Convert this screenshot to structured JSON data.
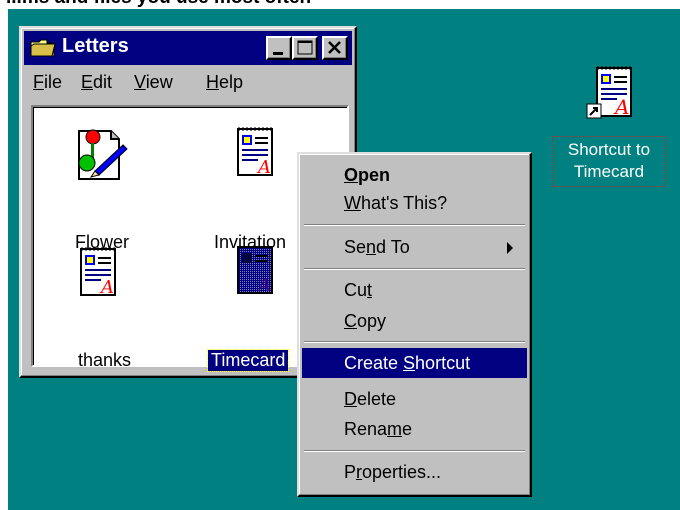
{
  "caption": "...ms and files you use most often",
  "window": {
    "title": "Letters",
    "menu": [
      "File",
      "Edit",
      "View",
      "Help"
    ],
    "files": [
      {
        "name": "Flower",
        "icon": "paint-document-icon"
      },
      {
        "name": "Invitation",
        "icon": "wordpad-document-icon"
      },
      {
        "name": "thanks",
        "icon": "wordpad-document-icon"
      },
      {
        "name": "Timecard",
        "icon": "wordpad-document-icon",
        "selected": true
      }
    ]
  },
  "context_menu": {
    "items": [
      {
        "label": "Open",
        "bold": true
      },
      {
        "label": "What's This?"
      },
      {
        "label": "Send To",
        "submenu": true
      },
      {
        "label": "Cut"
      },
      {
        "label": "Copy"
      },
      {
        "label": "Create Shortcut",
        "highlighted": true
      },
      {
        "label": "Delete"
      },
      {
        "label": "Rename"
      },
      {
        "label": "Properties..."
      }
    ]
  },
  "desktop": {
    "shortcut": {
      "line1": "Shortcut to",
      "line2": "Timecard",
      "icon": "wordpad-shortcut-icon"
    }
  },
  "colors": {
    "desktop": "#008080",
    "titlebar": "#000080",
    "highlight": "#000080",
    "face": "#c0c0c0"
  }
}
